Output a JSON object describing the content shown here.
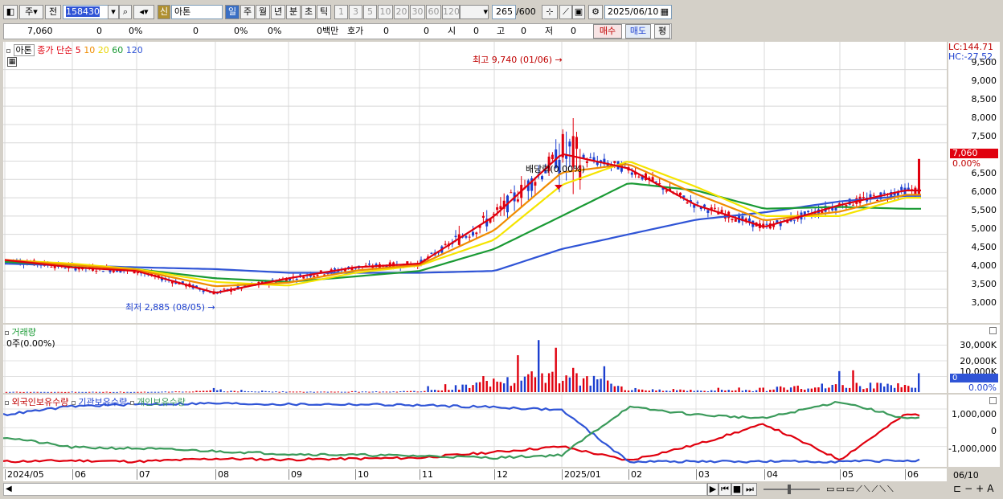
{
  "toolbar": {
    "mode_label": "주",
    "kind_label": "전",
    "code": "158430",
    "name": "아톤",
    "new_badge": "신",
    "periods": [
      "일",
      "주",
      "월",
      "년",
      "분",
      "초",
      "틱"
    ],
    "intervals": [
      "1",
      "3",
      "5",
      "10",
      "20",
      "30",
      "60",
      "120"
    ],
    "count_value": "265",
    "count_max": "/600",
    "date_value": "2025/06/10"
  },
  "quote_bar": {
    "price": "7,060",
    "v1": "0",
    "v1p": "0%",
    "v2": "0",
    "v2p": "0%",
    "v3p": "0%",
    "amount": "0백만",
    "hoga_label": "호가",
    "hoga": "0",
    "hoga2": "0",
    "si_label": "시",
    "si": "0",
    "go_label": "고",
    "go": "0",
    "jeo_label": "저",
    "jeo": "0",
    "buy": "매수",
    "sell": "매도",
    "avg": "평"
  },
  "price_pane": {
    "legend": {
      "name": "아톤",
      "label": "종가 단순",
      "ma": [
        "5",
        "10",
        "20",
        "60",
        "120"
      ]
    },
    "lc": "LC:144.71",
    "hc": "HC:-27.52",
    "high_note": "최고 9,740 (01/06)",
    "low_note": "최저 2,885 (08/05)",
    "dividend_note": "배당락(0.00%)",
    "current_tag": "7,060",
    "current_pct": "0.00%",
    "ticks": [
      "9,500",
      "9,000",
      "8,500",
      "8,000",
      "7,500",
      "7,000",
      "6,500",
      "6,000",
      "5,500",
      "5,000",
      "4,500",
      "4,000",
      "3,500",
      "3,000"
    ]
  },
  "volume_pane": {
    "title": "거래량",
    "value": "0주(0.00%)",
    "ticks": [
      "30,000K",
      "20,000K",
      "10,000K",
      "0.00%"
    ],
    "tag": "0"
  },
  "holder_pane": {
    "legend": [
      "외국인보유수량",
      "기관보유수량",
      "개인보유수량"
    ],
    "ticks": [
      "1,000,000",
      "0",
      "-1,000,000"
    ]
  },
  "xaxis": {
    "labels": [
      "2024/05",
      "06",
      "07",
      "08",
      "09",
      "10",
      "11",
      "12",
      "2025/01",
      "02",
      "03",
      "04",
      "05",
      "06"
    ],
    "right_label": "06/10"
  },
  "colors": {
    "candle_up": "#e0000e",
    "candle_down": "#1c3fcf",
    "ma5": "#e0000e",
    "ma10": "#f08c00",
    "ma20": "#f5e400",
    "ma60": "#1a9a34",
    "ma120": "#2f54d6",
    "foreign": "#e0000e",
    "inst": "#2f54d6",
    "indiv": "#3a9a5a"
  },
  "chart_data": [
    {
      "type": "line",
      "title": "아톤 종가 단순",
      "x": [
        "2024/05",
        "2024/06",
        "2024/07",
        "2024/08",
        "2024/09",
        "2024/10",
        "2024/11",
        "2024/12",
        "2025/01",
        "2025/02",
        "2025/03",
        "2025/04",
        "2025/05",
        "2025/06"
      ],
      "series": [
        {
          "name": "5",
          "values": [
            4300,
            4100,
            4000,
            3400,
            3800,
            4100,
            4200,
            5500,
            7200,
            6800,
            5800,
            5200,
            5800,
            6200
          ]
        },
        {
          "name": "60",
          "values": [
            4250,
            4150,
            4050,
            3800,
            3700,
            3850,
            4000,
            4600,
            5500,
            6400,
            6200,
            5700,
            5750,
            5700
          ]
        },
        {
          "name": "120",
          "values": [
            4200,
            4150,
            4100,
            4050,
            3950,
            3950,
            3950,
            4000,
            4600,
            5000,
            5400,
            5600,
            5900,
            6050
          ]
        }
      ],
      "ylim": [
        2600,
        9800
      ],
      "annotations": [
        "최고 9,740 (01/06)",
        "최저 2,885 (08/05)"
      ]
    },
    {
      "type": "bar",
      "title": "거래량",
      "x": [
        "2024/05",
        "2024/06",
        "2024/07",
        "2024/08",
        "2024/09",
        "2024/10",
        "2024/11",
        "2024/12",
        "2025/01",
        "2025/02",
        "2025/03",
        "2025/04",
        "2025/05",
        "2025/06"
      ],
      "values": [
        400,
        300,
        300,
        2500,
        900,
        700,
        1800,
        18000,
        36000,
        6000,
        3000,
        3500,
        14000,
        11000
      ],
      "ylim": [
        0,
        40000
      ]
    },
    {
      "type": "line",
      "title": "보유수량",
      "x": [
        "2024/05",
        "2024/06",
        "2024/07",
        "2024/08",
        "2024/09",
        "2024/10",
        "2024/11",
        "2024/12",
        "2025/01",
        "2025/02",
        "2025/03",
        "2025/04",
        "2025/05",
        "2025/06"
      ],
      "series": [
        {
          "name": "외국인보유수량",
          "values": [
            -1800000,
            -1750000,
            -1800000,
            -1650000,
            -1700000,
            -1650000,
            -1600000,
            -1300000,
            -1000000,
            -1750000,
            -900000,
            200000,
            -1700000,
            700000
          ]
        },
        {
          "name": "기관보유수량",
          "values": [
            700000,
            1150000,
            1250000,
            1300000,
            1250000,
            1250000,
            1200000,
            1100000,
            950000,
            -1800000,
            -1800000,
            -1800000,
            -1800000,
            -1750000
          ]
        },
        {
          "name": "개인보유수량",
          "values": [
            -500000,
            -1050000,
            -1100000,
            -1250000,
            -1400000,
            -1450000,
            -1500000,
            -1600000,
            -1450000,
            1100000,
            700000,
            500000,
            1400000,
            500000
          ]
        }
      ],
      "ylim": [
        -2000000,
        1600000
      ]
    }
  ]
}
